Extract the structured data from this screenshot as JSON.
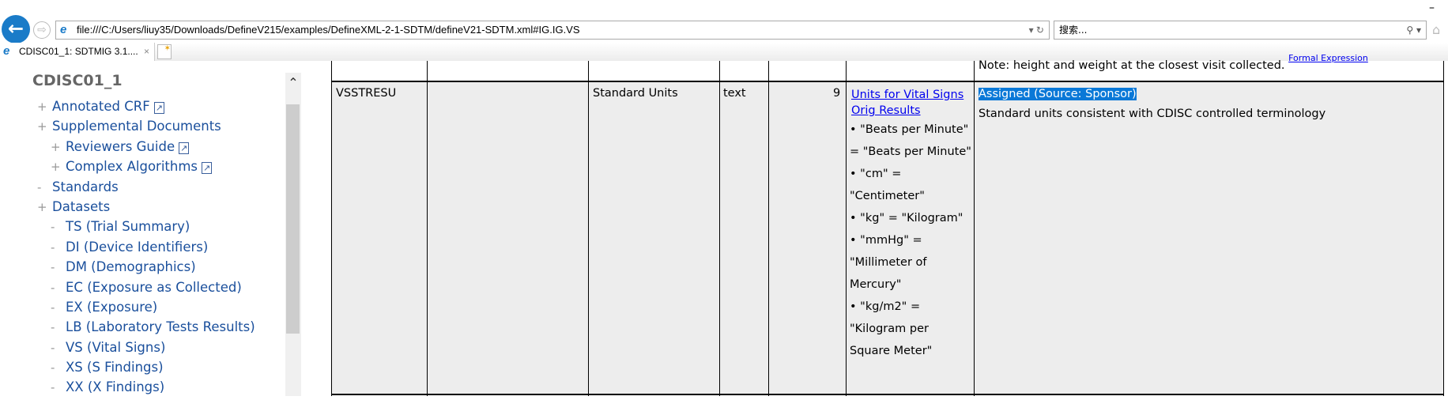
{
  "browser": {
    "address": "file:///C:/Users/liuy35/Downloads/DefineV215/examples/DefineXML-2-1-SDTM/defineV21-SDTM.xml#IG.IG.VS",
    "search_placeholder": "搜索...",
    "tab_title": "CDISC01_1: SDTMIG 3.1....",
    "tab_close": "×"
  },
  "sidebar": {
    "title": "CDISC01_1",
    "items": [
      {
        "mark": "+",
        "label": "Annotated CRF",
        "external": true
      },
      {
        "mark": "+",
        "label": "Supplemental Documents"
      },
      {
        "mark": "+",
        "label": "Reviewers Guide",
        "external": true
      },
      {
        "mark": "+",
        "label": "Complex Algorithms",
        "external": true
      },
      {
        "mark": "-",
        "label": "Standards"
      },
      {
        "mark": "+",
        "label": "Datasets"
      },
      {
        "mark": "-",
        "label": "TS (Trial Summary)"
      },
      {
        "mark": "-",
        "label": "DI (Device Identifiers)"
      },
      {
        "mark": "-",
        "label": "DM (Demographics)"
      },
      {
        "mark": "-",
        "label": "EC (Exposure as Collected)"
      },
      {
        "mark": "-",
        "label": "EX (Exposure)"
      },
      {
        "mark": "-",
        "label": "LB (Laboratory Tests Results)"
      },
      {
        "mark": "-",
        "label": "VS (Vital Signs)"
      },
      {
        "mark": "-",
        "label": "XS (S Findings)"
      },
      {
        "mark": "-",
        "label": "XX (X Findings)"
      }
    ]
  },
  "table": {
    "prev_row": {
      "note": "Note: height and weight at the closest visit collected.",
      "link": "Formal Expression"
    },
    "row": {
      "variable": "VSSTRESU",
      "label": "Standard Units",
      "type": "text",
      "length": "9",
      "codelist_link_1": "Units for Vital Signs",
      "codelist_link_2": "Orig Results",
      "codes": [
        "\"Beats per Minute\" = \"Beats per Minute\"",
        "\"cm\" = \"Centimeter\"",
        "\"kg\" = \"Kilogram\"",
        "\"mmHg\" = \"Millimeter of Mercury\"",
        "\"kg/m2\" = \"Kilogram per Square Meter\""
      ],
      "origin": "Assigned (Source: Sponsor)",
      "comment": "Standard units consistent with CDISC controlled terminology"
    }
  }
}
